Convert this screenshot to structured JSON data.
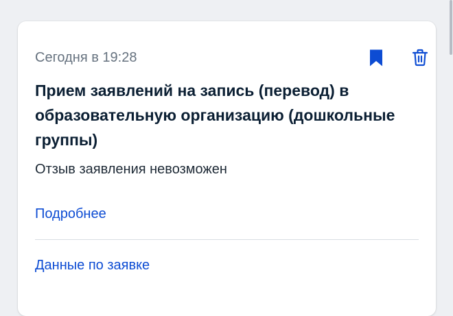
{
  "notification": {
    "date": "Сегодня в 19:28",
    "title": "Прием заявлений на запись (перевод) в образовательную организацию (дошкольные группы)",
    "status": "Отзыв заявления невозможен",
    "links": {
      "more": "Подробнее",
      "request_data": "Данные по заявке"
    }
  },
  "icons": {
    "bookmark": "bookmark-icon",
    "delete": "trash-icon"
  },
  "colors": {
    "accent": "#0d4cd3",
    "title": "#0b1f33",
    "muted": "#66727f",
    "background": "#eef0f3",
    "card": "#ffffff",
    "divider": "#d8dde3"
  }
}
